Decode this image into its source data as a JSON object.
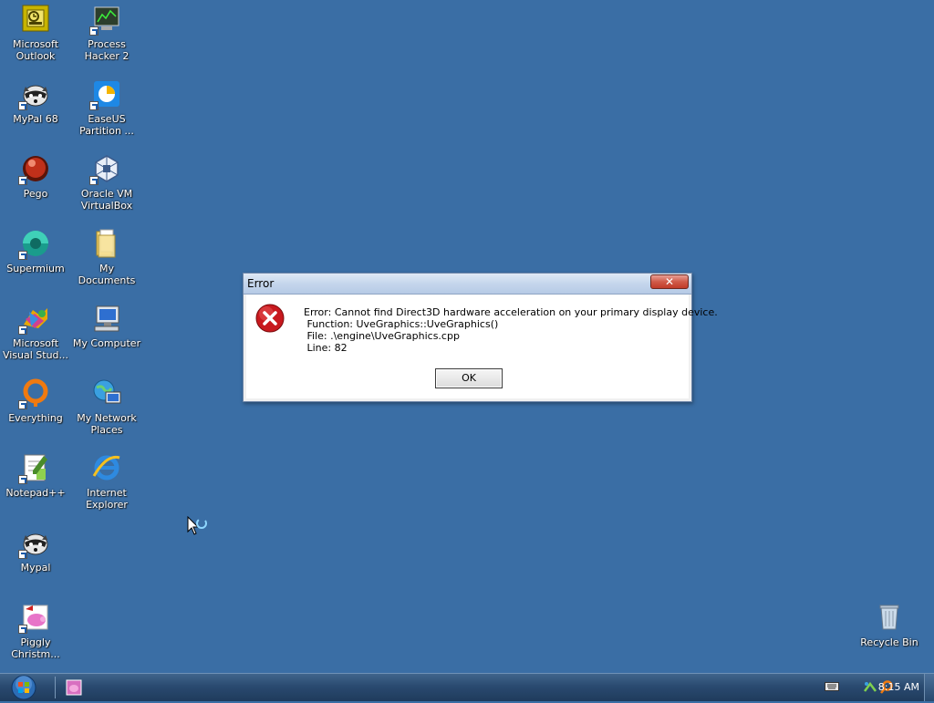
{
  "desktop": {
    "background": "#3a6ea5",
    "icons": [
      {
        "name": "outlook",
        "label": "Microsoft\nOutlook"
      },
      {
        "name": "processhacker",
        "label": "Process\nHacker 2"
      },
      {
        "name": "mypal68",
        "label": "MyPal 68"
      },
      {
        "name": "easeus",
        "label": "EaseUS\nPartition ..."
      },
      {
        "name": "pego",
        "label": "Pego"
      },
      {
        "name": "virtualbox",
        "label": "Oracle VM\nVirtualBox"
      },
      {
        "name": "supermium",
        "label": "Supermium"
      },
      {
        "name": "mydocuments",
        "label": "My\nDocuments"
      },
      {
        "name": "visualstudio",
        "label": "Microsoft\nVisual Stud..."
      },
      {
        "name": "mycomputer",
        "label": "My Computer"
      },
      {
        "name": "everything",
        "label": "Everything"
      },
      {
        "name": "networkplaces",
        "label": "My Network\nPlaces"
      },
      {
        "name": "notepadpp",
        "label": "Notepad++"
      },
      {
        "name": "ie",
        "label": "Internet\nExplorer"
      },
      {
        "name": "mypal",
        "label": "Mypal"
      },
      {
        "name": "piggy",
        "label": "Piggly\nChristm..."
      },
      {
        "name": "recyclebin",
        "label": "Recycle Bin"
      }
    ]
  },
  "dialog": {
    "title": "Error",
    "close_label": "✕",
    "message": {
      "line1": "Error: Cannot find Direct3D hardware acceleration on your primary display device.",
      "line2": " Function: UveGraphics::UveGraphics()",
      "line3": " File: .\\engine\\UveGraphics.cpp",
      "line4": " Line: 82"
    },
    "ok_label": "OK"
  },
  "taskbar": {
    "clock": "8:15 AM"
  }
}
